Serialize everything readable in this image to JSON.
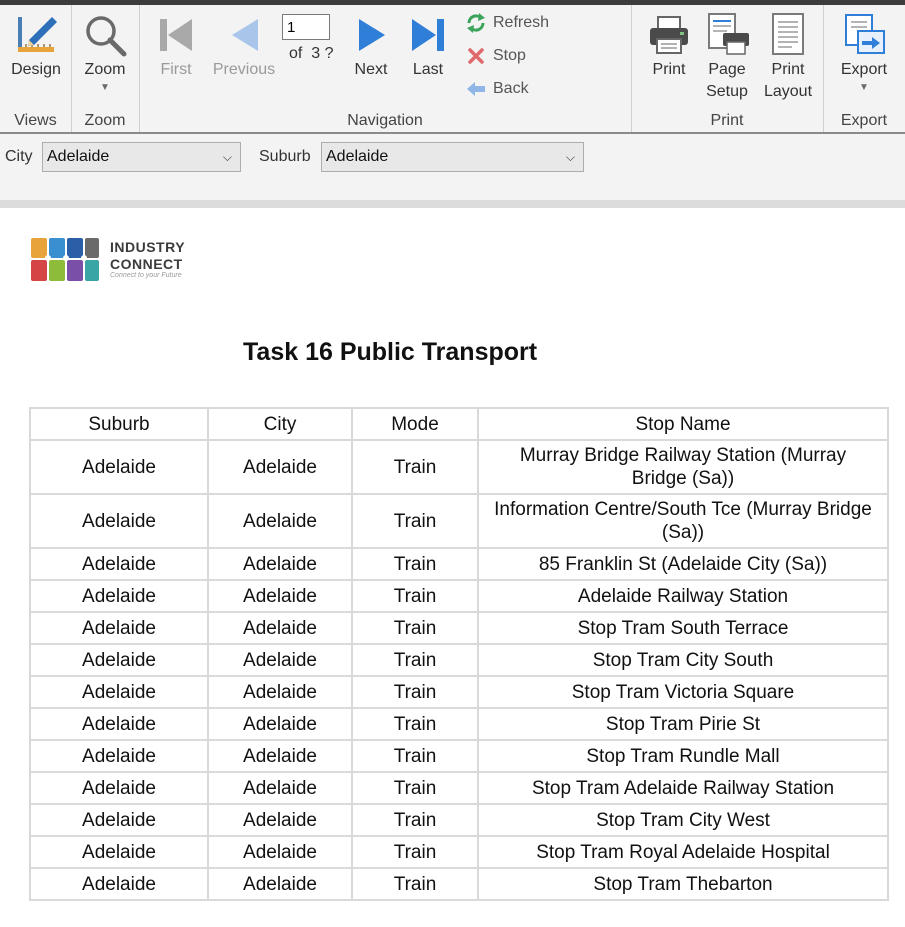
{
  "ribbon": {
    "views": {
      "group_label": "Views",
      "design_label": "Design",
      "design_icon": "design-pencil-ruler-icon"
    },
    "zoom": {
      "group_label": "Zoom",
      "zoom_label": "Zoom",
      "zoom_icon": "magnifier-icon"
    },
    "navigation": {
      "group_label": "Navigation",
      "first_label": "First",
      "previous_label": "Previous",
      "next_label": "Next",
      "last_label": "Last",
      "current_page": "1",
      "of_label": "of",
      "total_pages": "3 ?",
      "refresh_label": "Refresh",
      "stop_label": "Stop",
      "back_label": "Back"
    },
    "print": {
      "group_label": "Print",
      "print_label": "Print",
      "page_setup_label_1": "Page",
      "page_setup_label_2": "Setup",
      "print_layout_label_1": "Print",
      "print_layout_label_2": "Layout"
    },
    "export": {
      "group_label": "Export",
      "export_label": "Export"
    }
  },
  "parameters": {
    "city_label": "City",
    "city_value": "Adelaide",
    "suburb_label": "Suburb",
    "suburb_value": "Adelaide"
  },
  "report": {
    "logo_line1": "INDUSTRY",
    "logo_line2": "CONNECT",
    "logo_tagline": "Connect to your Future",
    "title": "Task 16 Public Transport",
    "columns": [
      "Suburb",
      "City",
      "Mode",
      "Stop Name"
    ],
    "rows": [
      {
        "suburb": "Adelaide",
        "city": "Adelaide",
        "mode": "Train",
        "stop_line1": "Murray Bridge Railway Station (Murray",
        "stop_line2": "Bridge (Sa))"
      },
      {
        "suburb": "Adelaide",
        "city": "Adelaide",
        "mode": "Train",
        "stop_line1": "Information Centre/South Tce (Murray Bridge",
        "stop_line2": "(Sa))"
      },
      {
        "suburb": "Adelaide",
        "city": "Adelaide",
        "mode": "Train",
        "stop": "85 Franklin St (Adelaide City (Sa))"
      },
      {
        "suburb": "Adelaide",
        "city": "Adelaide",
        "mode": "Train",
        "stop": "Adelaide Railway Station"
      },
      {
        "suburb": "Adelaide",
        "city": "Adelaide",
        "mode": "Train",
        "stop": "Stop Tram South Terrace"
      },
      {
        "suburb": "Adelaide",
        "city": "Adelaide",
        "mode": "Train",
        "stop": "Stop Tram City South"
      },
      {
        "suburb": "Adelaide",
        "city": "Adelaide",
        "mode": "Train",
        "stop": "Stop Tram Victoria Square"
      },
      {
        "suburb": "Adelaide",
        "city": "Adelaide",
        "mode": "Train",
        "stop": "Stop Tram Pirie St"
      },
      {
        "suburb": "Adelaide",
        "city": "Adelaide",
        "mode": "Train",
        "stop": "Stop Tram Rundle Mall"
      },
      {
        "suburb": "Adelaide",
        "city": "Adelaide",
        "mode": "Train",
        "stop": "Stop Tram Adelaide Railway Station"
      },
      {
        "suburb": "Adelaide",
        "city": "Adelaide",
        "mode": "Train",
        "stop": "Stop Tram City West"
      },
      {
        "suburb": "Adelaide",
        "city": "Adelaide",
        "mode": "Train",
        "stop": "Stop Tram Royal Adelaide Hospital"
      },
      {
        "suburb": "Adelaide",
        "city": "Adelaide",
        "mode": "Train",
        "stop": "Stop Tram Thebarton"
      }
    ]
  },
  "colors": {
    "ribbon_bg": "#f3f3f3",
    "nav_blue": "#2f7ed8",
    "disabled_gray": "#9a9a9a",
    "table_border": "#d9d9d9"
  }
}
